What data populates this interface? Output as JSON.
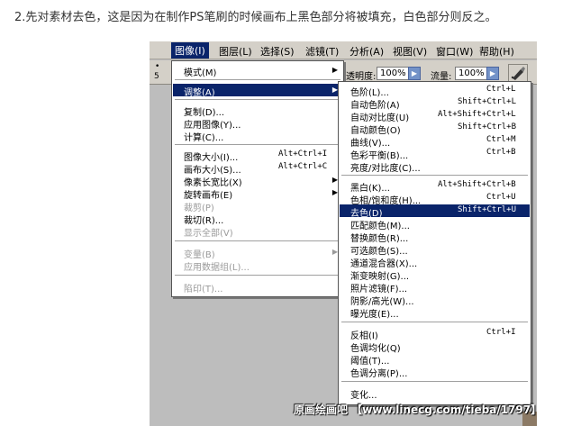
{
  "caption": "2.先对素材去色，这是因为在制作PS笔刷的时候画布上黑色部分将被填充，白色部分则反之。",
  "menubar": {
    "items": [
      {
        "label": "图像(I)",
        "active": true
      },
      {
        "label": "图层(L)"
      },
      {
        "label": "选择(S)"
      },
      {
        "label": "滤镜(T)"
      },
      {
        "label": "分析(A)"
      },
      {
        "label": "视图(V)"
      },
      {
        "label": "窗口(W)"
      },
      {
        "label": "帮助(H)"
      }
    ]
  },
  "toolbar": {
    "opacity_label": "透明度:",
    "opacity_value": "100%",
    "flow_label": "流量:",
    "flow_value": "100%",
    "left_number": "5",
    "left_dot": "•",
    "brush_icon": "airbrush-icon"
  },
  "image_menu": {
    "items": [
      {
        "label": "模式(M)",
        "arrow": true
      },
      {
        "label": "调整(A)",
        "arrow": true,
        "highlight": true
      },
      {
        "label": "复制(D)..."
      },
      {
        "label": "应用图像(Y)..."
      },
      {
        "label": "计算(C)..."
      },
      {
        "label": "图像大小(I)...",
        "shortcut": "Alt+Ctrl+I"
      },
      {
        "label": "画布大小(S)...",
        "shortcut": "Alt+Ctrl+C"
      },
      {
        "label": "像素长宽比(X)",
        "arrow": true
      },
      {
        "label": "旋转画布(E)",
        "arrow": true
      },
      {
        "label": "裁剪(P)",
        "disabled": true
      },
      {
        "label": "裁切(R)..."
      },
      {
        "label": "显示全部(V)",
        "disabled": true
      },
      {
        "label": "变量(B)",
        "arrow": true,
        "disabled": true
      },
      {
        "label": "应用数据组(L)...",
        "disabled": true
      },
      {
        "label": "陷印(T)...",
        "disabled": true
      }
    ]
  },
  "adjust_menu": {
    "items": [
      {
        "label": "色阶(L)...",
        "shortcut": "Ctrl+L"
      },
      {
        "label": "自动色阶(A)",
        "shortcut": "Shift+Ctrl+L"
      },
      {
        "label": "自动对比度(U)",
        "shortcut": "Alt+Shift+Ctrl+L"
      },
      {
        "label": "自动颜色(O)",
        "shortcut": "Shift+Ctrl+B"
      },
      {
        "label": "曲线(V)...",
        "shortcut": "Ctrl+M"
      },
      {
        "label": "色彩平衡(B)...",
        "shortcut": "Ctrl+B"
      },
      {
        "label": "亮度/对比度(C)..."
      },
      {
        "label": "黑白(K)...",
        "shortcut": "Alt+Shift+Ctrl+B"
      },
      {
        "label": "色相/饱和度(H)...",
        "shortcut": "Ctrl+U"
      },
      {
        "label": "去色(D)",
        "shortcut": "Shift+Ctrl+U",
        "highlight": true
      },
      {
        "label": "匹配颜色(M)..."
      },
      {
        "label": "替换颜色(R)..."
      },
      {
        "label": "可选颜色(S)..."
      },
      {
        "label": "通道混合器(X)..."
      },
      {
        "label": "渐变映射(G)..."
      },
      {
        "label": "照片滤镜(F)..."
      },
      {
        "label": "阴影/高光(W)..."
      },
      {
        "label": "曝光度(E)..."
      },
      {
        "label": "反相(I)",
        "shortcut": "Ctrl+I"
      },
      {
        "label": "色调均化(Q)"
      },
      {
        "label": "阈值(T)..."
      },
      {
        "label": "色调分离(P)..."
      },
      {
        "label": "变化..."
      }
    ]
  },
  "watermark": "原画绘画吧 【www.linecg.com/tieba/1797】"
}
